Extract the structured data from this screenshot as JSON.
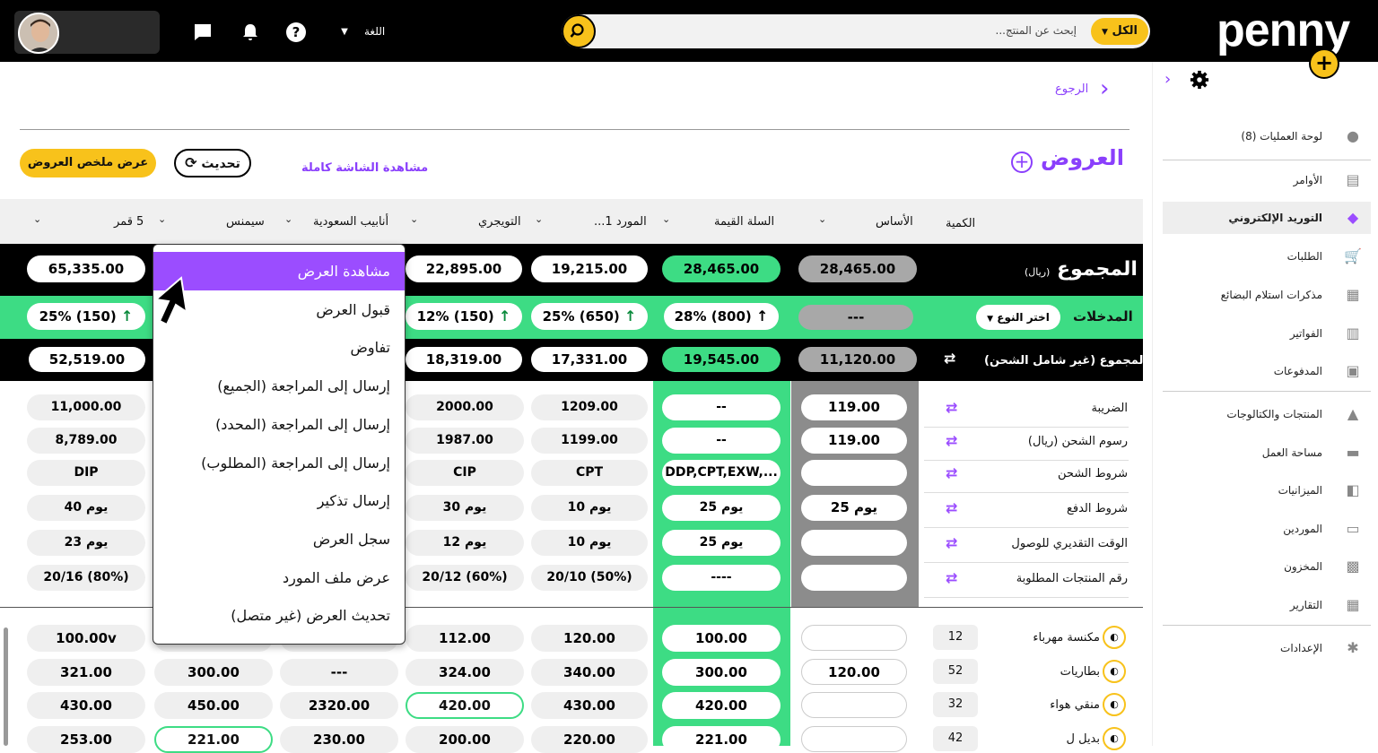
{
  "header": {
    "language_label": "اللغة",
    "search_placeholder": "إبحث عن المنتج...",
    "search_scope": "الكل",
    "logo": "penny"
  },
  "sidebar": {
    "items": [
      {
        "label": "لوحة العمليات (8)",
        "icon": "dashboard-icon"
      },
      {
        "label": "الأوامر",
        "icon": "orders-icon"
      },
      {
        "label": "التوريد الإلكتروني",
        "icon": "tag-icon",
        "active": true
      },
      {
        "label": "الطلبات",
        "icon": "cart-icon"
      },
      {
        "label": "مذكرات استلام البضائع",
        "icon": "receipt-icon"
      },
      {
        "label": "الفواتير",
        "icon": "invoice-icon"
      },
      {
        "label": "المدفوعات",
        "icon": "payment-icon"
      },
      {
        "label": "المنتجات والكتالوجات",
        "icon": "shapes-icon"
      },
      {
        "label": "مساحة العمل",
        "icon": "briefcase-icon"
      },
      {
        "label": "الميزانيات",
        "icon": "wallet-icon"
      },
      {
        "label": "الموردين",
        "icon": "store-icon"
      },
      {
        "label": "المخزون",
        "icon": "archive-icon"
      },
      {
        "label": "التقارير",
        "icon": "table-icon"
      },
      {
        "label": "الإعدادات",
        "icon": "gear-icon"
      }
    ]
  },
  "page": {
    "back_label": "الرجوع",
    "title": "العروض",
    "fullscreen_label": "مشاهدة الشاشة كاملة",
    "refresh_label": "تحديث",
    "summary_label": "عرض ملخص العروض"
  },
  "columns": {
    "qty": "الكمية",
    "base": "الأساس",
    "value_basket": "السلة القيمة",
    "supplier1": "المورد 1...",
    "tuwaijri": "التويجري",
    "saudi_pipes": "أنابيب السعودية",
    "siemens": "سيمنس",
    "qamar5": "5 قمر"
  },
  "total_row": {
    "label": "المجموع",
    "unit": "(ريال)",
    "values": [
      "28,465.00",
      "28,465.00",
      "19,215.00",
      "22,895.00",
      "65,335.00"
    ]
  },
  "inputs_row": {
    "label": "المدخلات",
    "type_select": "اختر النوع",
    "base": "---",
    "values": [
      "28% (800)",
      "25% (650)",
      "12% (150)",
      "25% (150)"
    ]
  },
  "total_excl_row": {
    "label": "المجموع (غير شامل الشحن)",
    "values": [
      "11,120.00",
      "19,545.00",
      "17,331.00",
      "18,319.00",
      "52,519.00"
    ]
  },
  "detail_rows": [
    {
      "label": "الضريبة",
      "base": "119.00",
      "basket": "--",
      "s1": "1209.00",
      "s2": "2000.00",
      "q5": "11,000.00"
    },
    {
      "label": "رسوم الشحن (ريال)",
      "base": "119.00",
      "basket": "--",
      "s1": "1199.00",
      "s2": "1987.00",
      "q5": "8,789.00"
    },
    {
      "label": "شروط الشحن",
      "base": "",
      "basket": "DDP,CPT,EXW,...",
      "s1": "CPT",
      "s2": "CIP",
      "q5": "DIP"
    },
    {
      "label": "شروط الدفع",
      "base": "25 يوم",
      "basket": "25 يوم",
      "s1": "10 يوم",
      "s2": "30 يوم",
      "q5": "40 يوم"
    },
    {
      "label": "الوقت التقديري للوصول",
      "base": "",
      "basket": "25 يوم",
      "s1": "10 يوم",
      "s2": "12 يوم",
      "q5": "23 يوم"
    },
    {
      "label": "رقم المنتجات المطلوبة",
      "base": "",
      "basket": "----",
      "s1": "20/10 (50%)",
      "s2": "20/12 (60%)",
      "q5": "20/16 (80%)"
    }
  ],
  "product_rows": [
    {
      "name": "مكنسة مهرباء",
      "qty": "12",
      "base": "",
      "basket": "100.00",
      "s1": "120.00",
      "s2": "112.00",
      "s3": "",
      "s4": "",
      "q5": "100.00v"
    },
    {
      "name": "بطاريات",
      "qty": "52",
      "base": "120.00",
      "basket": "300.00",
      "s1": "340.00",
      "s2": "324.00",
      "s3": "---",
      "s4": "300.00",
      "q5": "321.00"
    },
    {
      "name": "منقي هواء",
      "qty": "32",
      "base": "",
      "basket": "420.00",
      "s1": "430.00",
      "s2": "420.00",
      "s3": "2320.00",
      "s4": "450.00",
      "q5": "430.00"
    },
    {
      "name": "بديل ل",
      "qty": "42",
      "base": "",
      "basket": "221.00",
      "s1": "220.00",
      "s2": "200.00",
      "s3": "230.00",
      "s4": "221.00",
      "q5": "253.00"
    }
  ],
  "context_menu": {
    "items": [
      "مشاهدة العرض",
      "قبول العرض",
      "تفاوض",
      "إرسال إلى المراجعة (الجميع)",
      "إرسال إلى المراجعة (المحدد)",
      "إرسال إلى المراجعة (المطلوب)",
      "إرسال تذكير",
      "سجل العرض",
      "عرض ملف المورد",
      "تحديث العرض (غير متصل)"
    ],
    "selected_index": 0
  },
  "colors": {
    "accent": "#9b4dff",
    "yellow": "#f8c21b",
    "green": "#3ddc84",
    "black": "#000000"
  }
}
